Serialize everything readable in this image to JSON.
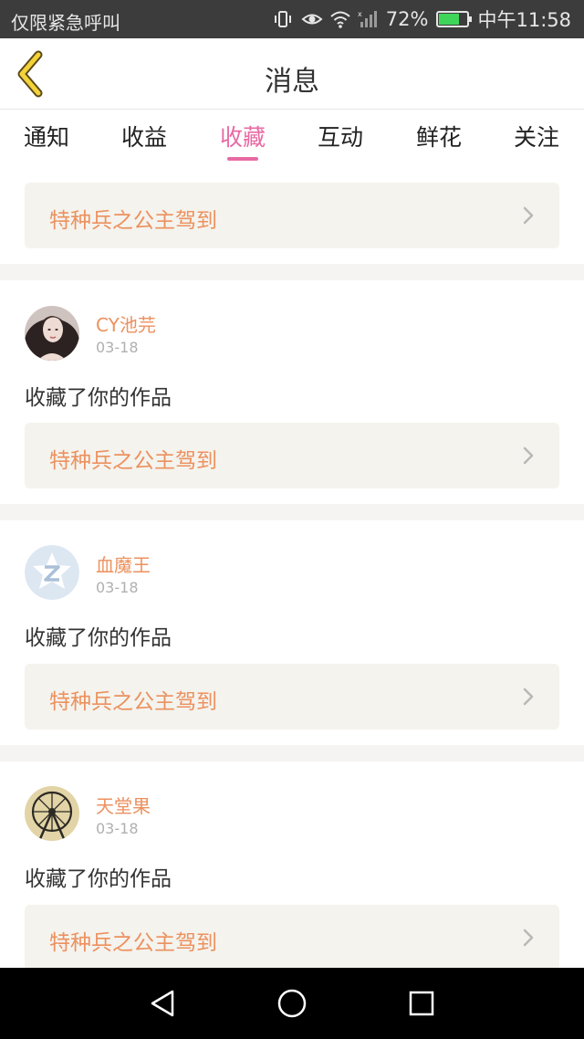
{
  "status_bar": {
    "carrier": "仅限紧急呼叫",
    "battery_pct": "72%",
    "time": "中午11:58",
    "battery_level": 0.72,
    "icons": [
      "vibrate-icon",
      "eye-icon",
      "wifi-icon",
      "signal-icon",
      "battery-icon"
    ]
  },
  "header": {
    "title": "消息",
    "back_icon": "chevron-left-icon"
  },
  "tabs": [
    {
      "label": "通知",
      "active": false
    },
    {
      "label": "收益",
      "active": false
    },
    {
      "label": "收藏",
      "active": true
    },
    {
      "label": "互动",
      "active": false
    },
    {
      "label": "鲜花",
      "active": false
    },
    {
      "label": "关注",
      "active": false
    }
  ],
  "colors": {
    "accent": "#e86aa3",
    "orange_text": "#ec915e",
    "card_bg": "#f4f3ee",
    "separator": "#f5f4f2",
    "status_bar_bg": "#3c3c3c",
    "nav_bar_bg": "#000000"
  },
  "feed": {
    "top_card": {
      "work_title": "特种兵之公主驾到"
    },
    "items": [
      {
        "user": "CY池芫",
        "date": "03-18",
        "action": "收藏了你的作品",
        "work_title": "特种兵之公主驾到",
        "avatar": "photo-avatar"
      },
      {
        "user": "血魔王",
        "date": "03-18",
        "action": "收藏了你的作品",
        "work_title": "特种兵之公主驾到",
        "avatar": "default-q-avatar"
      },
      {
        "user": "天堂果",
        "date": "03-18",
        "action": "收藏了你的作品",
        "work_title": "特种兵之公主驾到",
        "avatar": "ferris-wheel-avatar"
      }
    ]
  },
  "nav_bar": {
    "buttons": [
      "back-triangle-icon",
      "home-circle-icon",
      "recents-square-icon"
    ]
  }
}
